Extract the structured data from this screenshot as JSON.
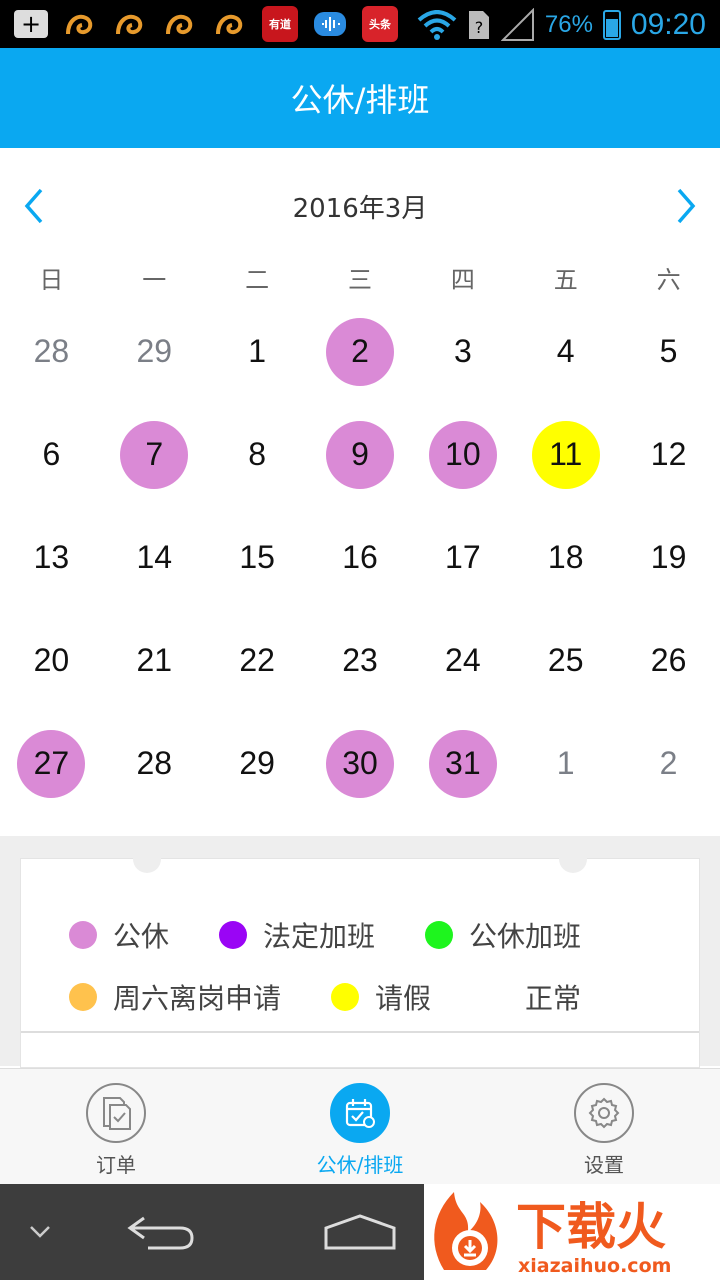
{
  "status_bar": {
    "battery_percent": "76%",
    "battery_level": 0.76,
    "time": "09:20",
    "app_labels": [
      "有道",
      "头条"
    ]
  },
  "title": "公休/排班",
  "calendar": {
    "month_label": "2016年3月",
    "weekdays": [
      "日",
      "一",
      "二",
      "三",
      "四",
      "五",
      "六"
    ],
    "days": [
      {
        "n": "28",
        "other": true,
        "status": ""
      },
      {
        "n": "29",
        "other": true,
        "status": ""
      },
      {
        "n": "1",
        "other": false,
        "status": ""
      },
      {
        "n": "2",
        "other": false,
        "status": "gongxiu"
      },
      {
        "n": "3",
        "other": false,
        "status": ""
      },
      {
        "n": "4",
        "other": false,
        "status": ""
      },
      {
        "n": "5",
        "other": false,
        "status": ""
      },
      {
        "n": "6",
        "other": false,
        "status": ""
      },
      {
        "n": "7",
        "other": false,
        "status": "gongxiu"
      },
      {
        "n": "8",
        "other": false,
        "status": ""
      },
      {
        "n": "9",
        "other": false,
        "status": "gongxiu"
      },
      {
        "n": "10",
        "other": false,
        "status": "gongxiu"
      },
      {
        "n": "11",
        "other": false,
        "status": "qingjia"
      },
      {
        "n": "12",
        "other": false,
        "status": ""
      },
      {
        "n": "13",
        "other": false,
        "status": ""
      },
      {
        "n": "14",
        "other": false,
        "status": ""
      },
      {
        "n": "15",
        "other": false,
        "status": ""
      },
      {
        "n": "16",
        "other": false,
        "status": ""
      },
      {
        "n": "17",
        "other": false,
        "status": ""
      },
      {
        "n": "18",
        "other": false,
        "status": ""
      },
      {
        "n": "19",
        "other": false,
        "status": ""
      },
      {
        "n": "20",
        "other": false,
        "status": ""
      },
      {
        "n": "21",
        "other": false,
        "status": ""
      },
      {
        "n": "22",
        "other": false,
        "status": ""
      },
      {
        "n": "23",
        "other": false,
        "status": ""
      },
      {
        "n": "24",
        "other": false,
        "status": ""
      },
      {
        "n": "25",
        "other": false,
        "status": ""
      },
      {
        "n": "26",
        "other": false,
        "status": ""
      },
      {
        "n": "27",
        "other": false,
        "status": "gongxiu"
      },
      {
        "n": "28",
        "other": false,
        "status": ""
      },
      {
        "n": "29",
        "other": false,
        "status": ""
      },
      {
        "n": "30",
        "other": false,
        "status": "gongxiu"
      },
      {
        "n": "31",
        "other": false,
        "status": "gongxiu"
      },
      {
        "n": "1",
        "other": true,
        "status": ""
      },
      {
        "n": "2",
        "other": true,
        "status": ""
      }
    ]
  },
  "legend": {
    "row1": [
      {
        "key": "gongxiu",
        "label": "公休",
        "color": "#da8ad6"
      },
      {
        "key": "fading",
        "label": "法定加班",
        "color": "#9a05f5"
      },
      {
        "key": "gongxiu_jiaban",
        "label": "公休加班",
        "color": "#1ef51e"
      }
    ],
    "row2": [
      {
        "key": "zhouliu",
        "label": "周六离岗申请",
        "color": "#ffc24d"
      },
      {
        "key": "qingjia",
        "label": "请假",
        "color": "#ffff00"
      },
      {
        "key": "zhengchang",
        "label": "正常",
        "color": ""
      }
    ]
  },
  "tabs": [
    {
      "label": "订单",
      "active": false
    },
    {
      "label": "公休/排班",
      "active": true
    },
    {
      "label": "设置",
      "active": false
    }
  ],
  "watermark": {
    "brand": "下载火",
    "domain": "xiazaihuo.com"
  },
  "colors": {
    "primary": "#0aa8f1",
    "status_blue": "#2aa7e6"
  }
}
